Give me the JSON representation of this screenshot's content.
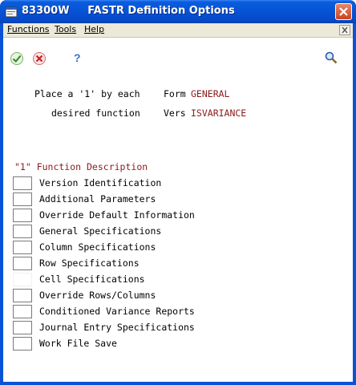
{
  "window": {
    "title": "83300W     FASTR Definition Options"
  },
  "menubar": {
    "items": [
      "Functions",
      "Tools",
      "Help"
    ]
  },
  "toolbar": {
    "ok_icon": "check-icon",
    "cancel_icon": "cancel-icon",
    "help_icon": "question-icon",
    "search_icon": "magnifier-icon"
  },
  "header": {
    "line1_prompt": "Place a '1' by each",
    "line2_prompt": "desired function",
    "form_label": "Form",
    "form_value": "GENERAL",
    "vers_label": "Vers",
    "vers_value": "ISVARIANCE"
  },
  "list": {
    "column_header": "\"1\" Function Description",
    "rows": [
      {
        "label": "Version Identification",
        "value": ""
      },
      {
        "label": "Additional Parameters",
        "value": ""
      },
      {
        "label": "Override Default Information",
        "value": ""
      },
      {
        "label": "General Specifications",
        "value": ""
      },
      {
        "label": "Column Specifications",
        "value": ""
      },
      {
        "label": "Row Specifications",
        "value": ""
      },
      {
        "label": "Cell Specifications",
        "value": ""
      },
      {
        "label": "Override Rows/Columns",
        "value": ""
      },
      {
        "label": "Conditioned Variance Reports",
        "value": ""
      },
      {
        "label": "Journal Entry Specifications",
        "value": ""
      },
      {
        "label": "Work File Save",
        "value": ""
      }
    ]
  },
  "colors": {
    "titlebar": "#0653d6",
    "accent_red": "#8b1a1a",
    "menubar": "#ece9d8"
  }
}
